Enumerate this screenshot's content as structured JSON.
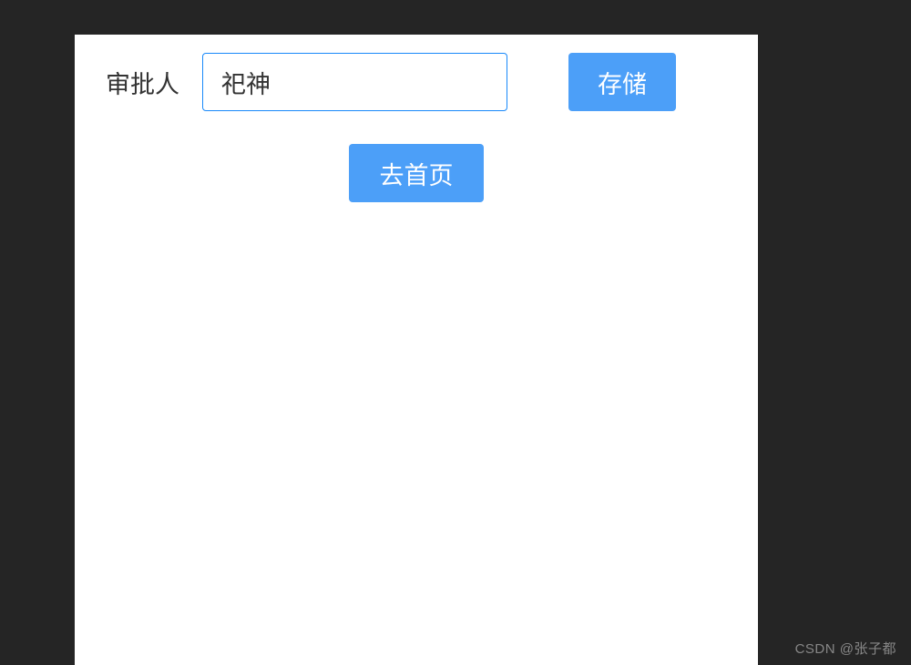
{
  "form": {
    "approver_label": "审批人",
    "approver_value": "祀神",
    "save_button": "存储",
    "home_button": "去首页"
  },
  "watermark": "CSDN @张子都"
}
